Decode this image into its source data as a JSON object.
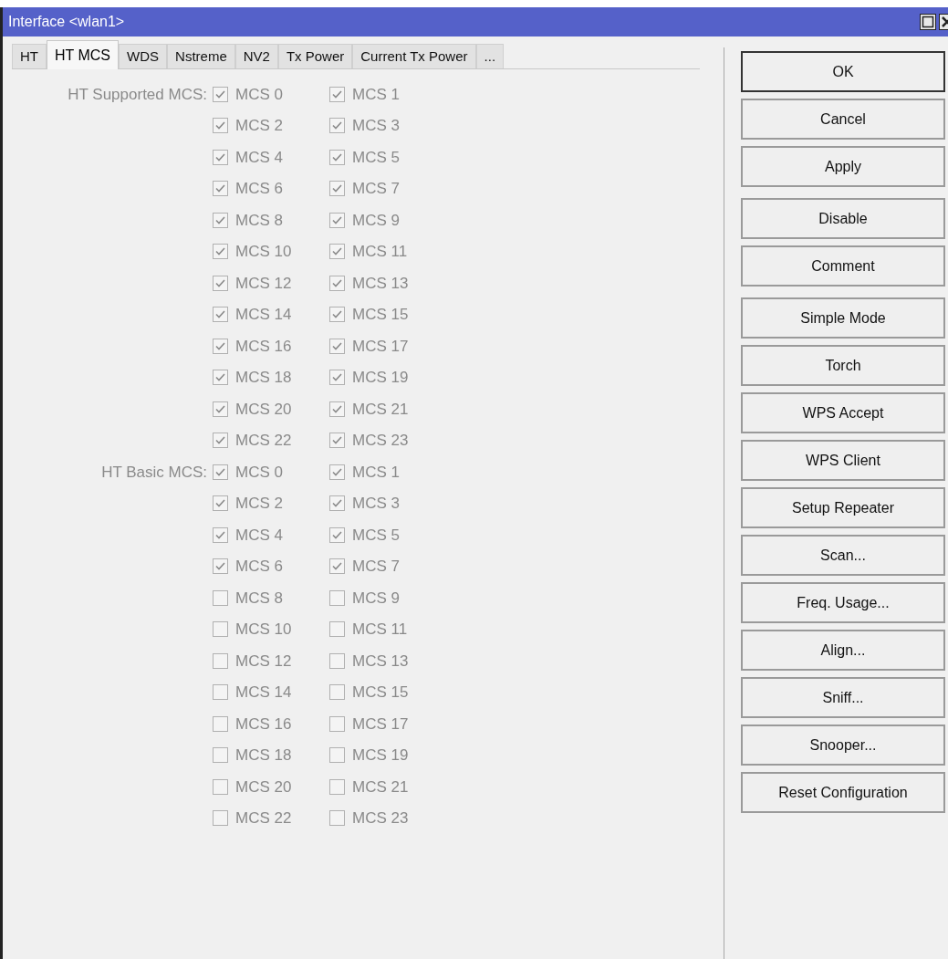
{
  "window": {
    "title": "Interface <wlan1>"
  },
  "tabs": [
    {
      "label": "HT",
      "selected": false
    },
    {
      "label": "HT MCS",
      "selected": true
    },
    {
      "label": "WDS",
      "selected": false
    },
    {
      "label": "Nstreme",
      "selected": false
    },
    {
      "label": "NV2",
      "selected": false
    },
    {
      "label": "Tx Power",
      "selected": false
    },
    {
      "label": "Current Tx Power",
      "selected": false
    },
    {
      "label": "...",
      "selected": false
    }
  ],
  "sections": [
    {
      "label": "HT Supported MCS:",
      "items": [
        {
          "label": "MCS 0",
          "checked": true
        },
        {
          "label": "MCS 1",
          "checked": true
        },
        {
          "label": "MCS 2",
          "checked": true
        },
        {
          "label": "MCS 3",
          "checked": true
        },
        {
          "label": "MCS 4",
          "checked": true
        },
        {
          "label": "MCS 5",
          "checked": true
        },
        {
          "label": "MCS 6",
          "checked": true
        },
        {
          "label": "MCS 7",
          "checked": true
        },
        {
          "label": "MCS 8",
          "checked": true
        },
        {
          "label": "MCS 9",
          "checked": true
        },
        {
          "label": "MCS 10",
          "checked": true
        },
        {
          "label": "MCS 11",
          "checked": true
        },
        {
          "label": "MCS 12",
          "checked": true
        },
        {
          "label": "MCS 13",
          "checked": true
        },
        {
          "label": "MCS 14",
          "checked": true
        },
        {
          "label": "MCS 15",
          "checked": true
        },
        {
          "label": "MCS 16",
          "checked": true
        },
        {
          "label": "MCS 17",
          "checked": true
        },
        {
          "label": "MCS 18",
          "checked": true
        },
        {
          "label": "MCS 19",
          "checked": true
        },
        {
          "label": "MCS 20",
          "checked": true
        },
        {
          "label": "MCS 21",
          "checked": true
        },
        {
          "label": "MCS 22",
          "checked": true
        },
        {
          "label": "MCS 23",
          "checked": true
        }
      ]
    },
    {
      "label": "HT Basic MCS:",
      "items": [
        {
          "label": "MCS 0",
          "checked": true
        },
        {
          "label": "MCS 1",
          "checked": true
        },
        {
          "label": "MCS 2",
          "checked": true
        },
        {
          "label": "MCS 3",
          "checked": true
        },
        {
          "label": "MCS 4",
          "checked": true
        },
        {
          "label": "MCS 5",
          "checked": true
        },
        {
          "label": "MCS 6",
          "checked": true
        },
        {
          "label": "MCS 7",
          "checked": true
        },
        {
          "label": "MCS 8",
          "checked": false
        },
        {
          "label": "MCS 9",
          "checked": false
        },
        {
          "label": "MCS 10",
          "checked": false
        },
        {
          "label": "MCS 11",
          "checked": false
        },
        {
          "label": "MCS 12",
          "checked": false
        },
        {
          "label": "MCS 13",
          "checked": false
        },
        {
          "label": "MCS 14",
          "checked": false
        },
        {
          "label": "MCS 15",
          "checked": false
        },
        {
          "label": "MCS 16",
          "checked": false
        },
        {
          "label": "MCS 17",
          "checked": false
        },
        {
          "label": "MCS 18",
          "checked": false
        },
        {
          "label": "MCS 19",
          "checked": false
        },
        {
          "label": "MCS 20",
          "checked": false
        },
        {
          "label": "MCS 21",
          "checked": false
        },
        {
          "label": "MCS 22",
          "checked": false
        },
        {
          "label": "MCS 23",
          "checked": false
        }
      ]
    }
  ],
  "button_groups": [
    [
      {
        "label": "OK",
        "default": true
      },
      {
        "label": "Cancel",
        "default": false
      },
      {
        "label": "Apply",
        "default": false
      }
    ],
    [
      {
        "label": "Disable",
        "default": false
      },
      {
        "label": "Comment",
        "default": false
      }
    ],
    [
      {
        "label": "Simple Mode",
        "default": false
      },
      {
        "label": "Torch",
        "default": false
      },
      {
        "label": "WPS Accept",
        "default": false
      },
      {
        "label": "WPS Client",
        "default": false
      },
      {
        "label": "Setup Repeater",
        "default": false
      },
      {
        "label": "Scan...",
        "default": false
      },
      {
        "label": "Freq. Usage...",
        "default": false
      },
      {
        "label": "Align...",
        "default": false
      },
      {
        "label": "Sniff...",
        "default": false
      },
      {
        "label": "Snooper...",
        "default": false
      },
      {
        "label": "Reset Configuration",
        "default": false
      }
    ]
  ]
}
